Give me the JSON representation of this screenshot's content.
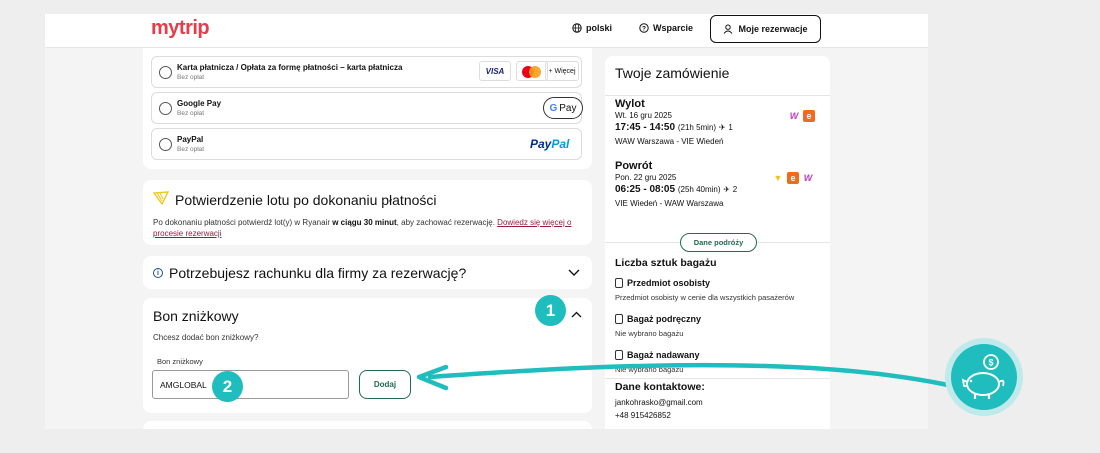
{
  "header": {
    "logo": "mytrip",
    "language": "polski",
    "support": "Wsparcie",
    "bookings_button": "Moje rezerwacje"
  },
  "payment": {
    "options": [
      {
        "title": "Karta płatnicza / Opłata za formę płatności – karta płatnicza",
        "desc": "Bez opłat",
        "logos": [
          "VISA",
          "mastercard",
          "+ Więcej"
        ]
      },
      {
        "title": "Google Pay",
        "desc": "Bez opłat",
        "logo": "G Pay"
      },
      {
        "title": "PayPal",
        "desc": "Bez opłat",
        "logo": "PayPal"
      }
    ],
    "visa_label": "VISA",
    "more_label": "+ Więcej",
    "gpay_g": "G",
    "gpay_label": "Pay",
    "paypal_a": "Pay",
    "paypal_b": "Pal"
  },
  "confirmation": {
    "title": "Potwierdzenie lotu po dokonaniu płatności",
    "text_before": "Po dokonaniu płatności potwierdź lot(y) w Ryanair ",
    "text_bold": "w ciągu 30 minut",
    "text_after": ", aby zachować rezerwację. ",
    "link": "Dowiedz się więcej o procesie rezerwacji"
  },
  "invoice": {
    "title": "Potrzebujesz rachunku dla firmy za rezerwację?"
  },
  "voucher": {
    "title": "Bon zniżkowy",
    "subtitle": "Chcesz dodać bon zniżkowy?",
    "field_label": "Bon zniżkowy",
    "field_value": "AMGLOBAL",
    "add_button": "Dodaj"
  },
  "order": {
    "title": "Twoje zamówienie",
    "outbound": {
      "heading": "Wylot",
      "date": "Wt. 16 gru 2025",
      "times": "17:45 - 14:50",
      "duration": "(21h 5min)",
      "stops": "1",
      "route": "WAW Warszawa - VIE Wiedeń"
    },
    "return": {
      "heading": "Powrót",
      "date": "Pon. 22 gru 2025",
      "times": "06:25 - 08:05",
      "duration": "(25h 40min)",
      "stops": "2",
      "route": "VIE Wiedeń - WAW Warszawa"
    },
    "details_pill": "Dane podróży",
    "baggage": {
      "title": "Liczba sztuk bagażu",
      "items": [
        {
          "name": "Przedmiot osobisty",
          "desc": "Przedmiot osobisty w cenie dla wszystkich pasażerów"
        },
        {
          "name": "Bagaż podręczny",
          "desc": "Nie wybrano bagażu"
        },
        {
          "name": "Bagaż nadawany",
          "desc": "Nie wybrano bagażu"
        }
      ]
    },
    "contact": {
      "title": "Dane kontaktowe:",
      "email": "jankohrasko@gmail.com",
      "phone": "+48 915426852"
    }
  },
  "annotations": {
    "step1": "1",
    "step2": "2",
    "accent_color": "#1fbdbd"
  }
}
